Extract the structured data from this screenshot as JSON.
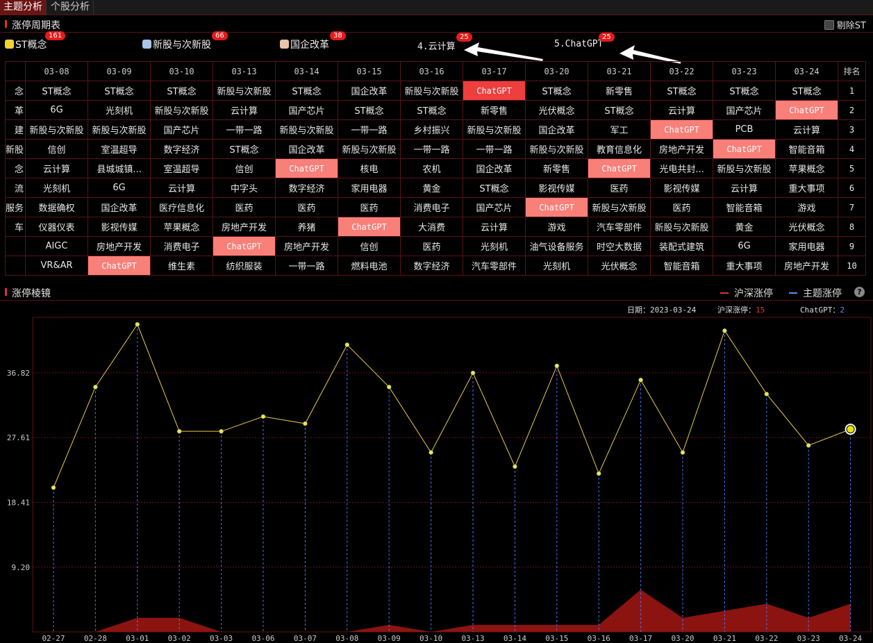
{
  "tabs": [
    "主题分析",
    "个股分析"
  ],
  "sections": {
    "period_table": "涨停周期表",
    "prism": "涨停棱镜"
  },
  "st_toggle_label": "剔除ST",
  "themes": [
    {
      "label": "ST概念",
      "count": "161",
      "color": "#f2d233"
    },
    {
      "label": "新股与次新股",
      "count": "66",
      "color": "#a9c6ea"
    },
    {
      "label": "国企改革",
      "count": "38",
      "color": "#e8c4a8"
    },
    {
      "label": "4.云计算",
      "count": "25",
      "color": ""
    },
    {
      "label": "5.ChatGPT",
      "count": "25",
      "color": ""
    }
  ],
  "table": {
    "rank_header": "排名",
    "dates": [
      "03-08",
      "03-09",
      "03-10",
      "03-13",
      "03-14",
      "03-15",
      "03-16",
      "03-17",
      "03-20",
      "03-21",
      "03-22",
      "03-23",
      "03-24"
    ],
    "first_col": [
      "念",
      "革",
      "建",
      "新股",
      "念",
      "流",
      "服务",
      "车",
      "",
      ""
    ],
    "rows": [
      [
        "ST概念",
        "ST概念",
        "ST概念",
        "新股与次新股",
        "ST概念",
        "国企改革",
        "新股与次新股",
        "ChatGPT",
        "ST概念",
        "新零售",
        "ST概念",
        "ST概念",
        "ST概念"
      ],
      [
        "6G",
        "光刻机",
        "新股与次新股",
        "云计算",
        "国产芯片",
        "ST概念",
        "ST概念",
        "新零售",
        "光伏概念",
        "ST概念",
        "云计算",
        "国产芯片",
        "ChatGPT"
      ],
      [
        "新股与次新股",
        "新股与次新股",
        "国产芯片",
        "一带一路",
        "新股与次新股",
        "一带一路",
        "乡村振兴",
        "新股与次新股",
        "国企改革",
        "军工",
        "ChatGPT",
        "PCB",
        "云计算"
      ],
      [
        "信创",
        "室温超导",
        "数字经济",
        "ST概念",
        "国企改革",
        "新股与次新股",
        "一带一路",
        "一带一路",
        "新股与次新股",
        "教育信息化",
        "房地产开发",
        "ChatGPT",
        "智能音箱"
      ],
      [
        "云计算",
        "县城城镇...",
        "室温超导",
        "信创",
        "ChatGPT",
        "核电",
        "农机",
        "国企改革",
        "新零售",
        "ChatGPT",
        "光电共封...",
        "新股与次新股",
        "苹果概念"
      ],
      [
        "光刻机",
        "6G",
        "云计算",
        "中字头",
        "数字经济",
        "家用电器",
        "黄金",
        "ST概念",
        "影视传媒",
        "医药",
        "影视传媒",
        "云计算",
        "重大事项"
      ],
      [
        "数据确权",
        "国企改革",
        "医疗信息化",
        "医药",
        "医药",
        "医药",
        "消费电子",
        "国产芯片",
        "ChatGPT",
        "新股与次新股",
        "医药",
        "智能音箱",
        "游戏"
      ],
      [
        "仪器仪表",
        "影视传媒",
        "苹果概念",
        "房地产开发",
        "养猪",
        "ChatGPT",
        "大消费",
        "云计算",
        "游戏",
        "汽车零部件",
        "新股与次新股",
        "黄金",
        "光伏概念"
      ],
      [
        "AIGC",
        "房地产开发",
        "消费电子",
        "ChatGPT",
        "房地产开发",
        "信创",
        "医药",
        "光刻机",
        "油气设备服务",
        "时空大数据",
        "装配式建筑",
        "6G",
        "家用电器"
      ],
      [
        "VR&AR",
        "ChatGPT",
        "维生素",
        "纺织服装",
        "一带一路",
        "燃料电池",
        "数字经济",
        "汽车零部件",
        "光刻机",
        "光伏概念",
        "智能音箱",
        "重大事项",
        "房地产开发"
      ]
    ],
    "ranks": [
      "1",
      "2",
      "3",
      "4",
      "5",
      "6",
      "7",
      "8",
      "9",
      "10"
    ]
  },
  "chart_info": {
    "date_label": "日期：",
    "date_value": "2023-03-24",
    "hs_label": "沪深涨停：",
    "hs_value": "15",
    "theme_label": "ChatGPT：",
    "theme_value": "2"
  },
  "colors": {
    "accent": "#e03232",
    "grid_border": "#5a1414",
    "highlight": "#f97f79",
    "highlight_strong": "#ef3e3e",
    "line": "#e8c94a",
    "area": "#8b1410",
    "theme_line": "#5a8bff"
  },
  "chart_data": {
    "type": "line",
    "legend": [
      "沪深涨停",
      "主题涨停"
    ],
    "legend_colors": [
      "#e33232",
      "#5a8bff"
    ],
    "x": [
      "02-27",
      "02-28",
      "03-01",
      "03-02",
      "03-03",
      "03-06",
      "03-07",
      "03-08",
      "03-09",
      "03-10",
      "03-13",
      "03-14",
      "03-15",
      "03-16",
      "03-17",
      "03-20",
      "03-21",
      "03-22",
      "03-23",
      "03-24"
    ],
    "yticks": [
      9.2,
      18.41,
      27.61,
      36.82
    ],
    "ylim": [
      0,
      44.7
    ],
    "series": [
      {
        "name": "沪深涨停",
        "values": [
          20.5,
          34.8,
          43.7,
          28.5,
          28.5,
          30.6,
          29.6,
          40.8,
          34.8,
          25.5,
          36.8,
          23.5,
          37.8,
          22.5,
          35.8,
          25.5,
          42.8,
          33.8,
          26.5,
          28.8
        ]
      },
      {
        "name": "主题涨停",
        "values": [
          0,
          0,
          2,
          2,
          0,
          0,
          0,
          0,
          1,
          0,
          1,
          1,
          1,
          1,
          6,
          2,
          3,
          4,
          2,
          4
        ]
      }
    ]
  }
}
